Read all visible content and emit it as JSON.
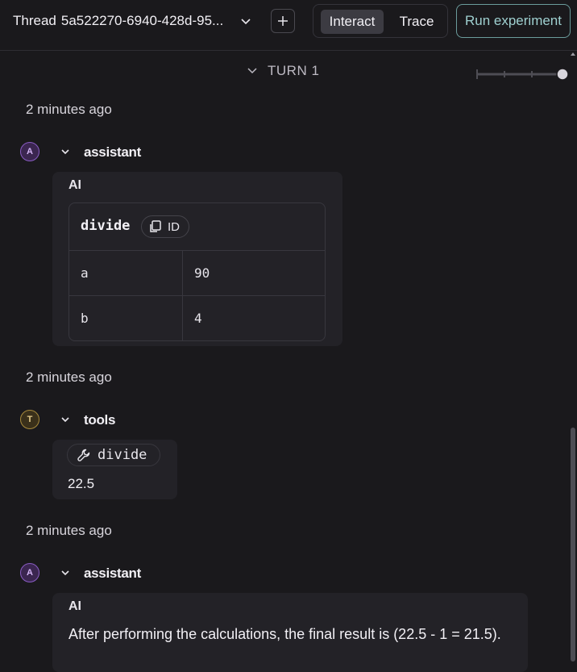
{
  "header": {
    "thread_label": "Thread",
    "thread_id": "5a522270-6940-428d-95...",
    "tabs": [
      {
        "label": "Interact",
        "active": true
      },
      {
        "label": "Trace",
        "active": false
      }
    ],
    "run_label": "Run experiment"
  },
  "turn": {
    "label": "TURN 1"
  },
  "messages": [
    {
      "timestamp": "2 minutes ago",
      "avatar": "A",
      "role": "assistant",
      "type_label": "AI",
      "tool_call": {
        "name": "divide",
        "id_label": "ID",
        "args": [
          {
            "key": "a",
            "value": "90"
          },
          {
            "key": "b",
            "value": "4"
          }
        ]
      }
    },
    {
      "timestamp": "2 minutes ago",
      "avatar": "T",
      "role": "tools",
      "tool_name": "divide",
      "result": "22.5"
    },
    {
      "timestamp": "2 minutes ago",
      "avatar": "A",
      "role": "assistant",
      "type_label": "AI",
      "content": "After performing the calculations, the final result is (22.5 - 1 = 21.5)."
    }
  ],
  "colors": {
    "background": "#1a191c",
    "card": "#232227",
    "accent_teal": "#9fd0d0",
    "assistant_avatar": "#8a5cc4",
    "tool_avatar": "#a88a3c"
  }
}
